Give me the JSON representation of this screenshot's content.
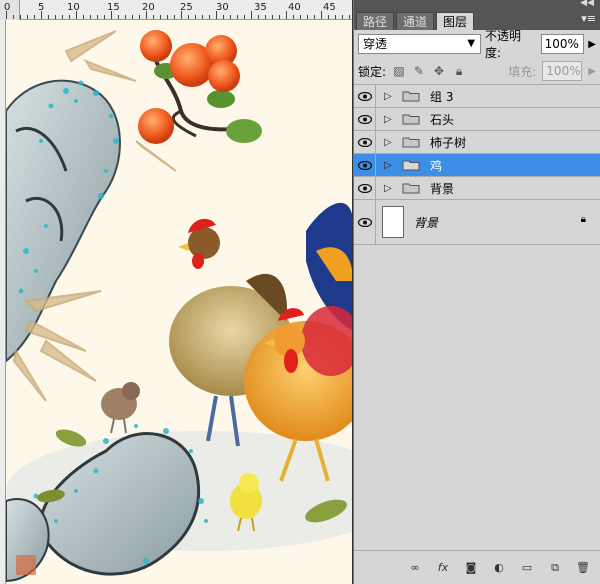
{
  "ruler": {
    "labels": [
      "0",
      "5",
      "10",
      "15",
      "20",
      "25",
      "30",
      "35",
      "40",
      "45"
    ]
  },
  "panel": {
    "tabs": [
      {
        "label": "路径",
        "active": false
      },
      {
        "label": "通道",
        "active": false
      },
      {
        "label": "图层",
        "active": true
      }
    ],
    "blend_mode": "穿透",
    "opacity_label": "不透明度:",
    "opacity_value": "100%",
    "lock_label": "锁定:",
    "fill_label": "填充:",
    "fill_value": "100%",
    "layers": [
      {
        "name": "组 3",
        "type": "group",
        "selected": false
      },
      {
        "name": "石头",
        "type": "group",
        "selected": false
      },
      {
        "name": "柿子树",
        "type": "group",
        "selected": false
      },
      {
        "name": "鸡",
        "type": "group",
        "selected": true
      },
      {
        "name": "背景",
        "type": "group",
        "selected": false
      },
      {
        "name": "背景",
        "type": "background",
        "selected": false
      }
    ]
  },
  "colors": {
    "selection": "#3d8ee6",
    "panel_bg": "#d6d6d6",
    "canvas_bg": "#fdf8ea"
  }
}
